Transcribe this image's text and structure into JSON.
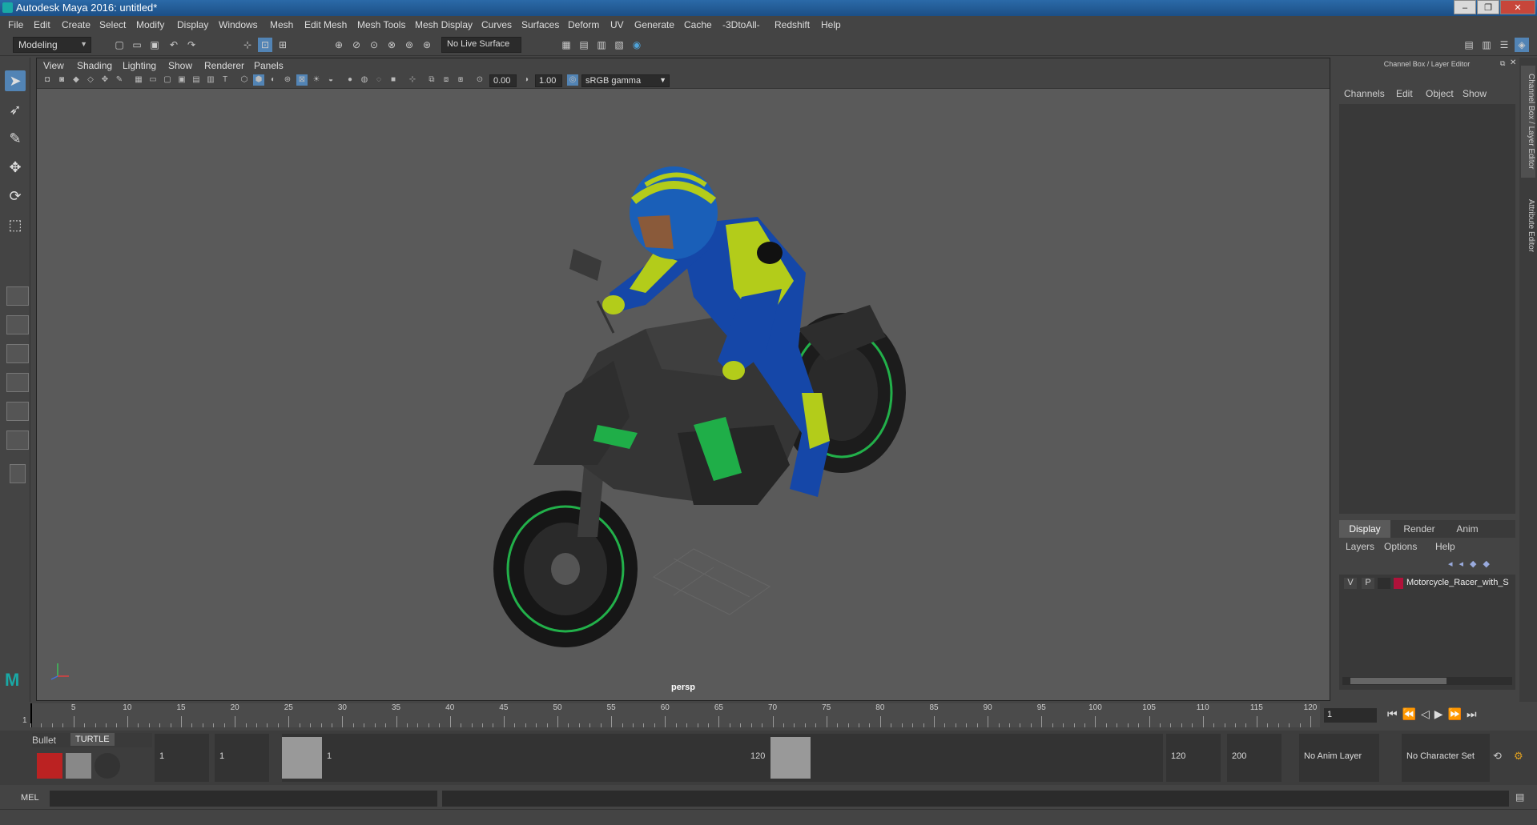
{
  "window": {
    "title": "Autodesk Maya 2016: untitled*"
  },
  "menubar": {
    "items": [
      "File",
      "Edit",
      "Create",
      "Select",
      "Modify",
      "Display",
      "Windows",
      "Mesh",
      "Edit Mesh",
      "Mesh Tools",
      "Mesh Display",
      "Curves",
      "Surfaces",
      "Deform",
      "UV",
      "Generate",
      "Cache",
      "-3DtoAll-",
      "Redshift",
      "Help"
    ]
  },
  "statusline": {
    "mode": "Modeling",
    "live_surface": "No Live Surface"
  },
  "viewport": {
    "menu": [
      "View",
      "Shading",
      "Lighting",
      "Show",
      "Renderer",
      "Panels"
    ],
    "exposure": "0.00",
    "gamma": "1.00",
    "color_space": "sRGB gamma",
    "camera_label": "persp"
  },
  "channel_box": {
    "header": "Channel Box / Layer Editor",
    "menu": [
      "Channels",
      "Edit",
      "Object",
      "Show"
    ]
  },
  "layer_editor": {
    "tabs": [
      "Display",
      "Render",
      "Anim"
    ],
    "menu": [
      "Layers",
      "Options",
      "Help"
    ],
    "layer": {
      "v": "V",
      "p": "P",
      "name": "Motorcycle_Racer_with_S",
      "color": "#b0123a"
    }
  },
  "side_tabs": [
    "Channel Box / Layer Editor",
    "Attribute Editor"
  ],
  "time_slider": {
    "ticks": [
      "5",
      "10",
      "15",
      "20",
      "25",
      "30",
      "35",
      "40",
      "45",
      "50",
      "55",
      "60",
      "65",
      "70",
      "75",
      "80",
      "85",
      "90",
      "95",
      "100",
      "105",
      "110",
      "115",
      "120"
    ],
    "start_marker": "1",
    "current_frame": "1"
  },
  "shelf": {
    "tabs": [
      "Bullet",
      "TURTLE"
    ]
  },
  "range": {
    "start": "1",
    "playback_start": "1",
    "range_start_label": "1",
    "range_end_label": "120",
    "playback_end": "120",
    "end": "200",
    "anim_layer": "No Anim Layer",
    "character_set": "No Character Set"
  },
  "command_line": {
    "label": "MEL"
  },
  "icons": [
    "select-arrow-icon",
    "lasso-icon",
    "paint-icon",
    "move-icon",
    "rotate-icon",
    "scale-icon",
    "play-icon",
    "skip-end-icon",
    "skip-start-icon"
  ]
}
